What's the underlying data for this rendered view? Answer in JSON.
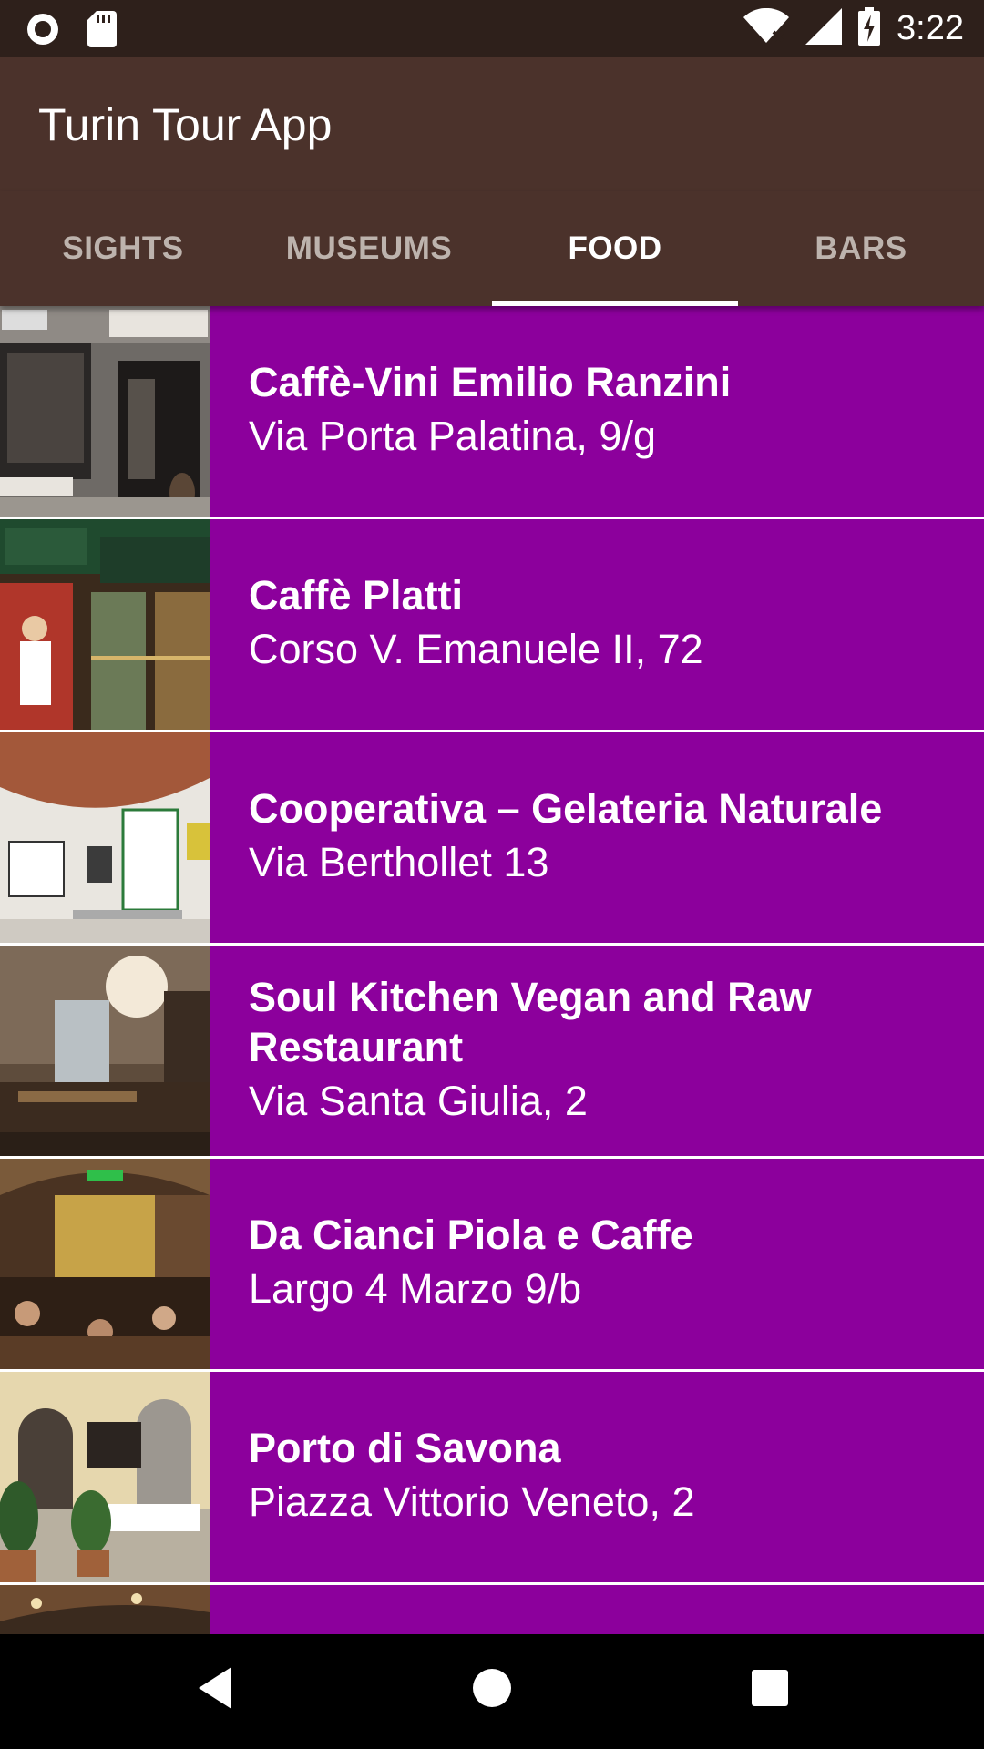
{
  "status_bar": {
    "time": "3:22",
    "icons": [
      "record-icon",
      "sd-card-icon",
      "wifi-icon",
      "signal-icon",
      "battery-charging-icon"
    ]
  },
  "app_bar": {
    "title": "Turin Tour App"
  },
  "tabs": [
    {
      "label": "SIGHTS",
      "active": false
    },
    {
      "label": "MUSEUMS",
      "active": false
    },
    {
      "label": "FOOD",
      "active": true
    },
    {
      "label": "BARS",
      "active": false
    }
  ],
  "colors": {
    "status_bar": "#2e201b",
    "app_bar": "#4b322b",
    "list_item": "#8c009c",
    "tab_inactive": "#bdb3ad",
    "tab_active": "#ffffff"
  },
  "places": [
    {
      "name": "Caffè-Vini Emilio Ranzini",
      "address": "Via Porta Palatina, 9/g"
    },
    {
      "name": "Caffè Platti",
      "address": "Corso V. Emanuele II, 72"
    },
    {
      "name": "Cooperativa – Gelateria Naturale",
      "address": "Via Berthollet 13"
    },
    {
      "name": "Soul Kitchen Vegan and Raw Restaurant",
      "address": "Via Santa Giulia, 2"
    },
    {
      "name": "Da Cianci Piola e Caffe",
      "address": "Largo 4 Marzo 9/b"
    },
    {
      "name": "Porto di Savona",
      "address": "Piazza Vittorio Veneto, 2"
    },
    {
      "name": "",
      "address": ""
    }
  ],
  "nav_bar": {
    "buttons": [
      "back-icon",
      "home-icon",
      "recents-icon"
    ]
  }
}
